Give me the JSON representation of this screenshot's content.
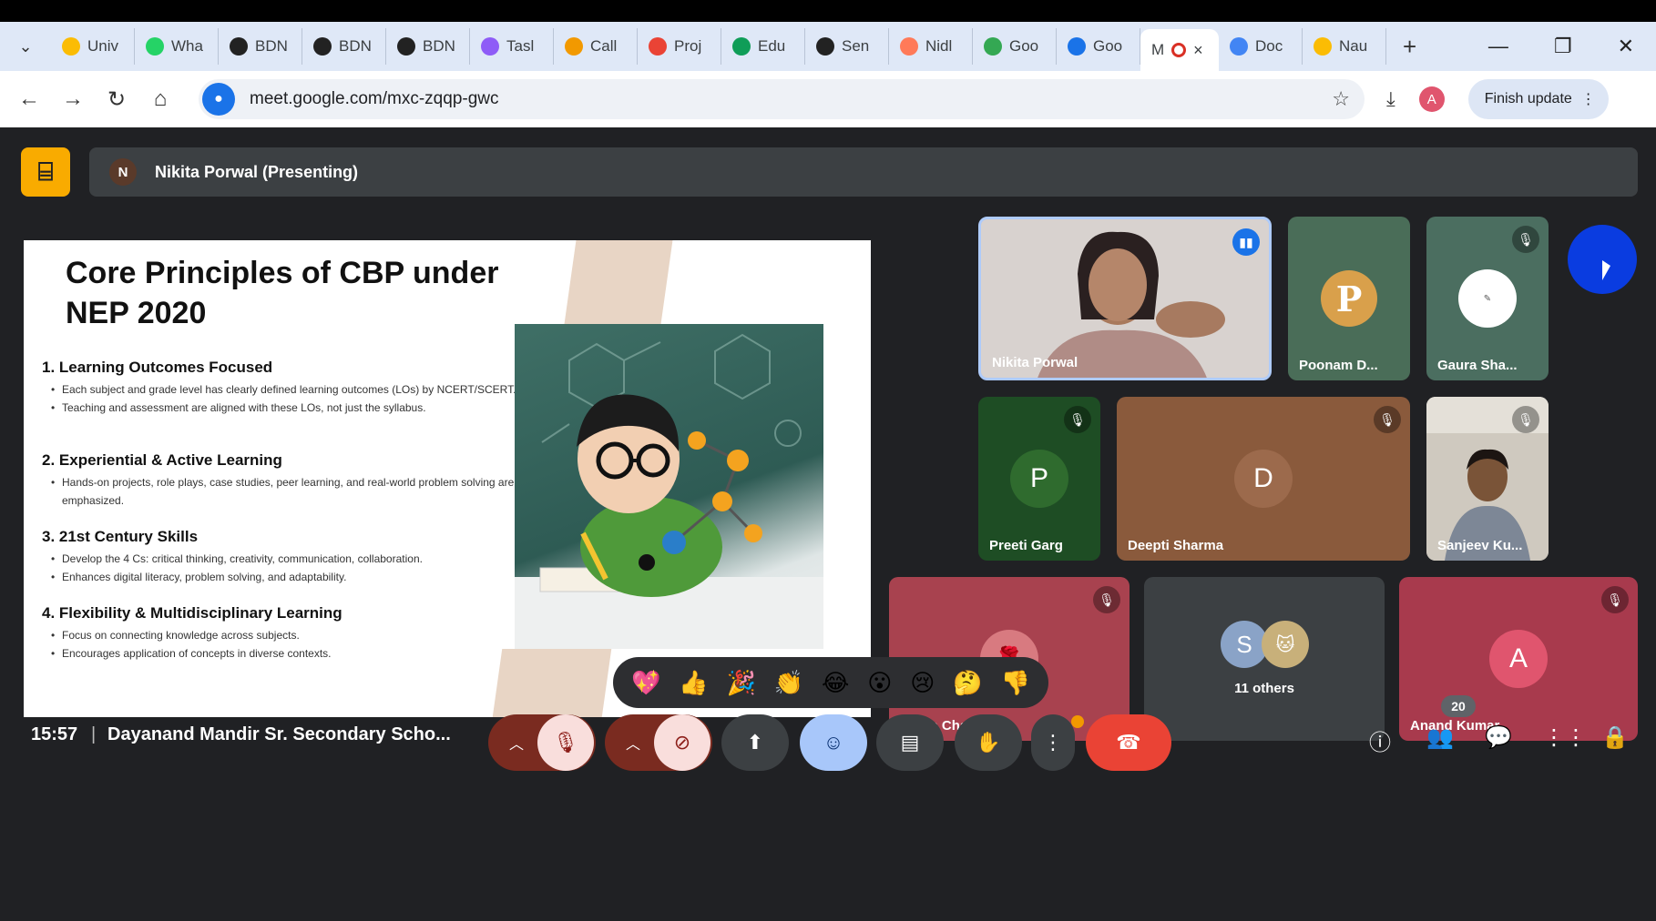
{
  "browser": {
    "tabs": [
      {
        "label": "Univ",
        "icon": "drive-icon",
        "color": "#fbbc04"
      },
      {
        "label": "Wha",
        "icon": "whatsapp-icon",
        "color": "#25d366"
      },
      {
        "label": "BDN",
        "icon": "globe-icon",
        "color": "#222222"
      },
      {
        "label": "BDN",
        "icon": "globe-icon",
        "color": "#222222"
      },
      {
        "label": "BDN",
        "icon": "globe-icon",
        "color": "#222222"
      },
      {
        "label": "Tasl",
        "icon": "app-icon",
        "color": "#8e5cf7"
      },
      {
        "label": "Call",
        "icon": "call-icon",
        "color": "#f29900"
      },
      {
        "label": "Proj",
        "icon": "gmail-icon",
        "color": "#ea4335"
      },
      {
        "label": "Edu",
        "icon": "sheets-icon",
        "color": "#0f9d58"
      },
      {
        "label": "Sen",
        "icon": "openai-icon",
        "color": "#222222"
      },
      {
        "label": "Nidl",
        "icon": "hubspot-icon",
        "color": "#ff7a59"
      },
      {
        "label": "Goo",
        "icon": "classroom-icon",
        "color": "#34a853"
      },
      {
        "label": "Goo",
        "icon": "forms-icon",
        "color": "#1a73e8"
      }
    ],
    "active_tab": {
      "label": "M",
      "icon": "recording-icon",
      "close": "×"
    },
    "tabs_after": [
      {
        "label": "Doc",
        "icon": "docs-icon",
        "color": "#4285f4"
      },
      {
        "label": "Nau",
        "icon": "drive-icon",
        "color": "#fbbc04"
      }
    ],
    "new_tab": "+",
    "window_controls": {
      "minimize": "—",
      "restore": "❐",
      "close": "✕"
    },
    "url": "meet.google.com/mxc-zqqp-gwc",
    "profile_initial": "A",
    "finish_update": "Finish update"
  },
  "meet": {
    "presenter": {
      "initial": "N",
      "label": "Nikita Porwal (Presenting)"
    },
    "slide": {
      "title": "Core Principles of CBP under NEP 2020",
      "sections": [
        {
          "heading": "1. Learning Outcomes Focused",
          "items": [
            "Each subject and grade level has clearly defined learning outcomes (LOs) by NCERT/SCERT.",
            "Teaching and assessment are aligned with these LOs, not just the syllabus."
          ]
        },
        {
          "heading": "2. Experiential & Active Learning",
          "items": [
            "Hands-on projects, role plays, case studies, peer learning, and real-world problem solving are emphasized."
          ]
        },
        {
          "heading": "3. 21st Century Skills",
          "items": [
            "Develop the 4 Cs: critical thinking, creativity, communication, collaboration.",
            "Enhances digital literacy, problem solving, and adaptability."
          ]
        },
        {
          "heading": "4. Flexibility & Multidisciplinary Learning",
          "items": [
            "Focus on connecting knowledge across subjects.",
            "Encourages application of concepts in diverse contexts."
          ]
        }
      ]
    },
    "participants": {
      "nikita": {
        "name": "Nikita Porwal"
      },
      "poonam": {
        "name": "Poonam D...",
        "initial": "P"
      },
      "gaura": {
        "name": "Gaura Sha..."
      },
      "preeti": {
        "name": "Preeti Garg",
        "initial": "P"
      },
      "deepti": {
        "name": "Deepti Sharma",
        "initial": "D"
      },
      "sanjeev": {
        "name": "Sanjeev Ku..."
      },
      "sarita": {
        "name": "Sarita Chauhan"
      },
      "others": {
        "initial": "S",
        "label": "11 others"
      },
      "anand": {
        "name": "Anand Kumar",
        "initial": "A"
      }
    },
    "reactions": [
      "💖",
      "👍",
      "🎉",
      "👏",
      "😂",
      "😮",
      "😢",
      "🤔",
      "👎"
    ],
    "bottom": {
      "time": "15:57",
      "separator": "|",
      "meeting_title": "Dayanand Mandir Sr. Secondary Scho...",
      "people_count": "20"
    }
  }
}
